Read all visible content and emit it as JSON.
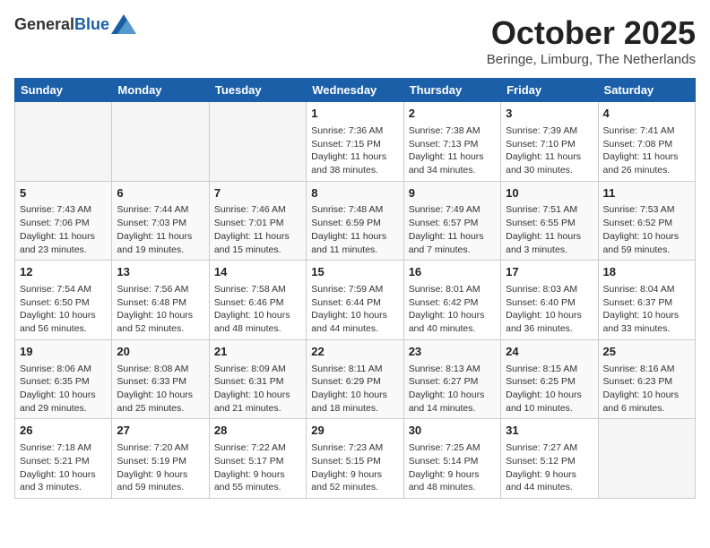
{
  "logo": {
    "general": "General",
    "blue": "Blue"
  },
  "title": "October 2025",
  "location": "Beringe, Limburg, The Netherlands",
  "weekdays": [
    "Sunday",
    "Monday",
    "Tuesday",
    "Wednesday",
    "Thursday",
    "Friday",
    "Saturday"
  ],
  "weeks": [
    [
      {
        "day": "",
        "info": ""
      },
      {
        "day": "",
        "info": ""
      },
      {
        "day": "",
        "info": ""
      },
      {
        "day": "1",
        "info": "Sunrise: 7:36 AM\nSunset: 7:15 PM\nDaylight: 11 hours\nand 38 minutes."
      },
      {
        "day": "2",
        "info": "Sunrise: 7:38 AM\nSunset: 7:13 PM\nDaylight: 11 hours\nand 34 minutes."
      },
      {
        "day": "3",
        "info": "Sunrise: 7:39 AM\nSunset: 7:10 PM\nDaylight: 11 hours\nand 30 minutes."
      },
      {
        "day": "4",
        "info": "Sunrise: 7:41 AM\nSunset: 7:08 PM\nDaylight: 11 hours\nand 26 minutes."
      }
    ],
    [
      {
        "day": "5",
        "info": "Sunrise: 7:43 AM\nSunset: 7:06 PM\nDaylight: 11 hours\nand 23 minutes."
      },
      {
        "day": "6",
        "info": "Sunrise: 7:44 AM\nSunset: 7:03 PM\nDaylight: 11 hours\nand 19 minutes."
      },
      {
        "day": "7",
        "info": "Sunrise: 7:46 AM\nSunset: 7:01 PM\nDaylight: 11 hours\nand 15 minutes."
      },
      {
        "day": "8",
        "info": "Sunrise: 7:48 AM\nSunset: 6:59 PM\nDaylight: 11 hours\nand 11 minutes."
      },
      {
        "day": "9",
        "info": "Sunrise: 7:49 AM\nSunset: 6:57 PM\nDaylight: 11 hours\nand 7 minutes."
      },
      {
        "day": "10",
        "info": "Sunrise: 7:51 AM\nSunset: 6:55 PM\nDaylight: 11 hours\nand 3 minutes."
      },
      {
        "day": "11",
        "info": "Sunrise: 7:53 AM\nSunset: 6:52 PM\nDaylight: 10 hours\nand 59 minutes."
      }
    ],
    [
      {
        "day": "12",
        "info": "Sunrise: 7:54 AM\nSunset: 6:50 PM\nDaylight: 10 hours\nand 56 minutes."
      },
      {
        "day": "13",
        "info": "Sunrise: 7:56 AM\nSunset: 6:48 PM\nDaylight: 10 hours\nand 52 minutes."
      },
      {
        "day": "14",
        "info": "Sunrise: 7:58 AM\nSunset: 6:46 PM\nDaylight: 10 hours\nand 48 minutes."
      },
      {
        "day": "15",
        "info": "Sunrise: 7:59 AM\nSunset: 6:44 PM\nDaylight: 10 hours\nand 44 minutes."
      },
      {
        "day": "16",
        "info": "Sunrise: 8:01 AM\nSunset: 6:42 PM\nDaylight: 10 hours\nand 40 minutes."
      },
      {
        "day": "17",
        "info": "Sunrise: 8:03 AM\nSunset: 6:40 PM\nDaylight: 10 hours\nand 36 minutes."
      },
      {
        "day": "18",
        "info": "Sunrise: 8:04 AM\nSunset: 6:37 PM\nDaylight: 10 hours\nand 33 minutes."
      }
    ],
    [
      {
        "day": "19",
        "info": "Sunrise: 8:06 AM\nSunset: 6:35 PM\nDaylight: 10 hours\nand 29 minutes."
      },
      {
        "day": "20",
        "info": "Sunrise: 8:08 AM\nSunset: 6:33 PM\nDaylight: 10 hours\nand 25 minutes."
      },
      {
        "day": "21",
        "info": "Sunrise: 8:09 AM\nSunset: 6:31 PM\nDaylight: 10 hours\nand 21 minutes."
      },
      {
        "day": "22",
        "info": "Sunrise: 8:11 AM\nSunset: 6:29 PM\nDaylight: 10 hours\nand 18 minutes."
      },
      {
        "day": "23",
        "info": "Sunrise: 8:13 AM\nSunset: 6:27 PM\nDaylight: 10 hours\nand 14 minutes."
      },
      {
        "day": "24",
        "info": "Sunrise: 8:15 AM\nSunset: 6:25 PM\nDaylight: 10 hours\nand 10 minutes."
      },
      {
        "day": "25",
        "info": "Sunrise: 8:16 AM\nSunset: 6:23 PM\nDaylight: 10 hours\nand 6 minutes."
      }
    ],
    [
      {
        "day": "26",
        "info": "Sunrise: 7:18 AM\nSunset: 5:21 PM\nDaylight: 10 hours\nand 3 minutes."
      },
      {
        "day": "27",
        "info": "Sunrise: 7:20 AM\nSunset: 5:19 PM\nDaylight: 9 hours\nand 59 minutes."
      },
      {
        "day": "28",
        "info": "Sunrise: 7:22 AM\nSunset: 5:17 PM\nDaylight: 9 hours\nand 55 minutes."
      },
      {
        "day": "29",
        "info": "Sunrise: 7:23 AM\nSunset: 5:15 PM\nDaylight: 9 hours\nand 52 minutes."
      },
      {
        "day": "30",
        "info": "Sunrise: 7:25 AM\nSunset: 5:14 PM\nDaylight: 9 hours\nand 48 minutes."
      },
      {
        "day": "31",
        "info": "Sunrise: 7:27 AM\nSunset: 5:12 PM\nDaylight: 9 hours\nand 44 minutes."
      },
      {
        "day": "",
        "info": ""
      }
    ]
  ]
}
